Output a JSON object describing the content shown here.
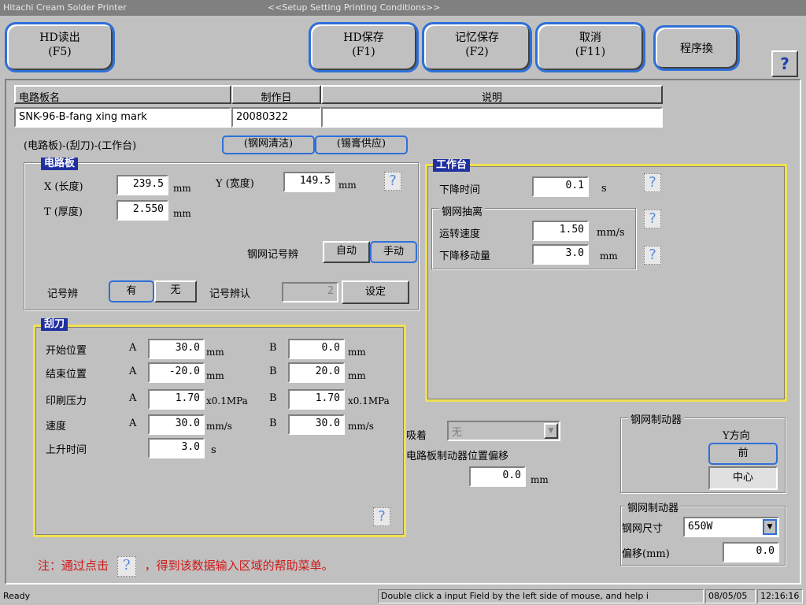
{
  "window": {
    "app_title": "Hitachi Cream Solder Printer",
    "screen_title": "<<Setup Setting Printing Conditions>>"
  },
  "toolbar": {
    "hd_read": "HD读出\n(F5)",
    "hd_save": "HD保存\n(F1)",
    "mem_save": "记忆保存\n(F2)",
    "cancel": "取消\n(F11)",
    "program_switch": "程序換",
    "help": "?"
  },
  "board_info": {
    "name_header": "电路板名",
    "date_header": "制作日",
    "desc_header": "说明",
    "name_value": "SNK-96-B-fang xing mark",
    "date_value": "20080322",
    "desc_value": ""
  },
  "tabs": {
    "path_label": "(电路板)-(刮刀)-(工作台)",
    "stencil_clean": "(钢网清洁)",
    "paste_supply": "(锡膏供应)"
  },
  "board": {
    "title": "电路板",
    "x_label": "X (长度)",
    "x_value": "239.5",
    "y_label": "Y (宽度)",
    "y_value": "149.5",
    "t_label": "T (厚度)",
    "t_value": "2.550",
    "unit_mm": "mm",
    "mark_label": "钢网记号辨",
    "auto": "自动",
    "manual": "手动",
    "fid_label": "记号辨",
    "fid_yes": "有",
    "fid_no": "无",
    "fid_confirm_label": "记号辨认",
    "fid_confirm_value": "2",
    "set_button": "设定",
    "help": "?"
  },
  "table": {
    "title": "工作台",
    "down_time_label": "下降时间",
    "down_time_value": "0.1",
    "down_time_unit": "s",
    "separation_title": "钢网抽离",
    "speed_label": "运转速度",
    "speed_value": "1.50",
    "speed_unit": "mm/s",
    "down_move_label": "下降移动量",
    "down_move_value": "3.0",
    "down_move_unit": "mm",
    "help": "?"
  },
  "squeegee": {
    "title": "刮刀",
    "a": "A",
    "b": "B",
    "rows": [
      {
        "label": "开始位置",
        "a_value": "30.0",
        "a_unit": "mm",
        "b_value": "0.0",
        "b_unit": "mm"
      },
      {
        "label": "结束位置",
        "a_value": "-20.0",
        "a_unit": "mm",
        "b_value": "20.0",
        "b_unit": "mm"
      },
      {
        "label": "印刷压力",
        "a_value": "1.70",
        "a_unit": "x0.1MPa",
        "b_value": "1.70",
        "b_unit": "x0.1MPa"
      },
      {
        "label": "速度",
        "a_value": "30.0",
        "a_unit": "mm/s",
        "b_value": "30.0",
        "b_unit": "mm/s"
      }
    ],
    "rise_label": "上升时间",
    "rise_value": "3.0",
    "rise_unit": "s",
    "help": "?"
  },
  "suction": {
    "label": "吸着",
    "value": "无",
    "offset_label": "电路板制动器位置偏移",
    "offset_value": "0.0",
    "offset_unit": "mm"
  },
  "stencil_stopper": {
    "title": "钢网制动器",
    "y_dir": "Y方向",
    "front": "前",
    "center": "中心"
  },
  "stencil_stopper2": {
    "title": "钢网制动器",
    "size_label": "钢网尺寸",
    "size_value": "650W",
    "offset_label": "偏移(mm)",
    "offset_value": "0.0"
  },
  "note": {
    "prefix": "注：通过点击",
    "help": "?",
    "suffix": "，得到该数据输入区域的帮助菜单。"
  },
  "status": {
    "ready": "Ready",
    "hint": "Double click a input Field by the left side of mouse, and help i",
    "date": "08/05/05",
    "time": "12:16:16"
  },
  "colors": {
    "accent_blue": "#2f6fd8",
    "group_title_bg": "#2030a0",
    "yellow_frame": "#f0e050",
    "note_red": "#d01818"
  }
}
